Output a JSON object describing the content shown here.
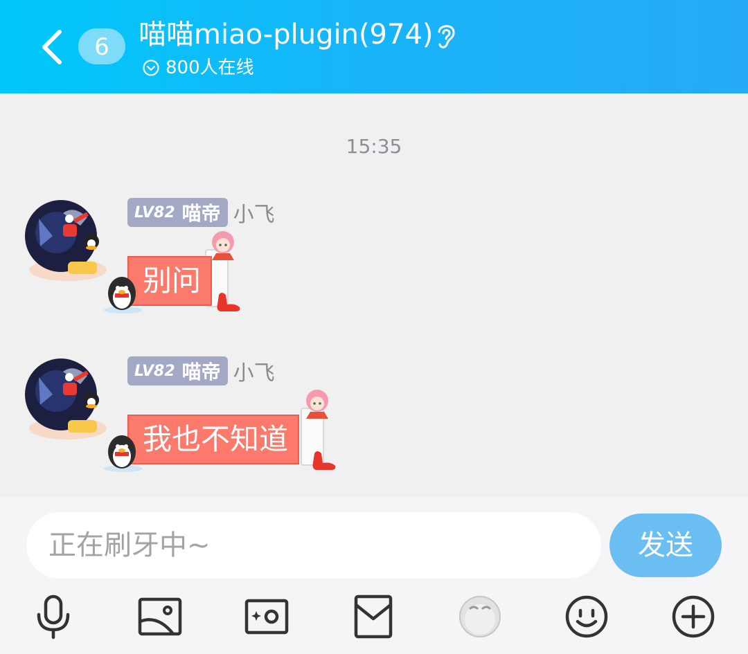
{
  "header": {
    "back_icon": "chevron-left-icon",
    "unread_count": "6",
    "title": "喵喵miao-plugin(974)",
    "ear_icon": "ear-icon",
    "online_text": "800人在线",
    "online_icon": "circle-chevron-icon"
  },
  "chat": {
    "time_label": "15:35",
    "messages": [
      {
        "level": "LV82",
        "title": "喵帝",
        "nickname": "小飞",
        "text": "别问"
      },
      {
        "level": "LV82",
        "title": "喵帝",
        "nickname": "小飞",
        "text": "我也不知道"
      }
    ]
  },
  "composer": {
    "placeholder": "正在刷牙中~",
    "send_label": "发送",
    "tools": [
      "microphone-icon",
      "image-icon",
      "camera-icon",
      "red-packet-icon",
      "sticker-icon",
      "emoji-icon",
      "plus-icon"
    ]
  },
  "colors": {
    "header_start": "#00c8fa",
    "header_end": "#26aaf6",
    "bubble": "#fb7a6c",
    "send_button": "#6bbef2",
    "level_tag": "#a3a8c4"
  }
}
